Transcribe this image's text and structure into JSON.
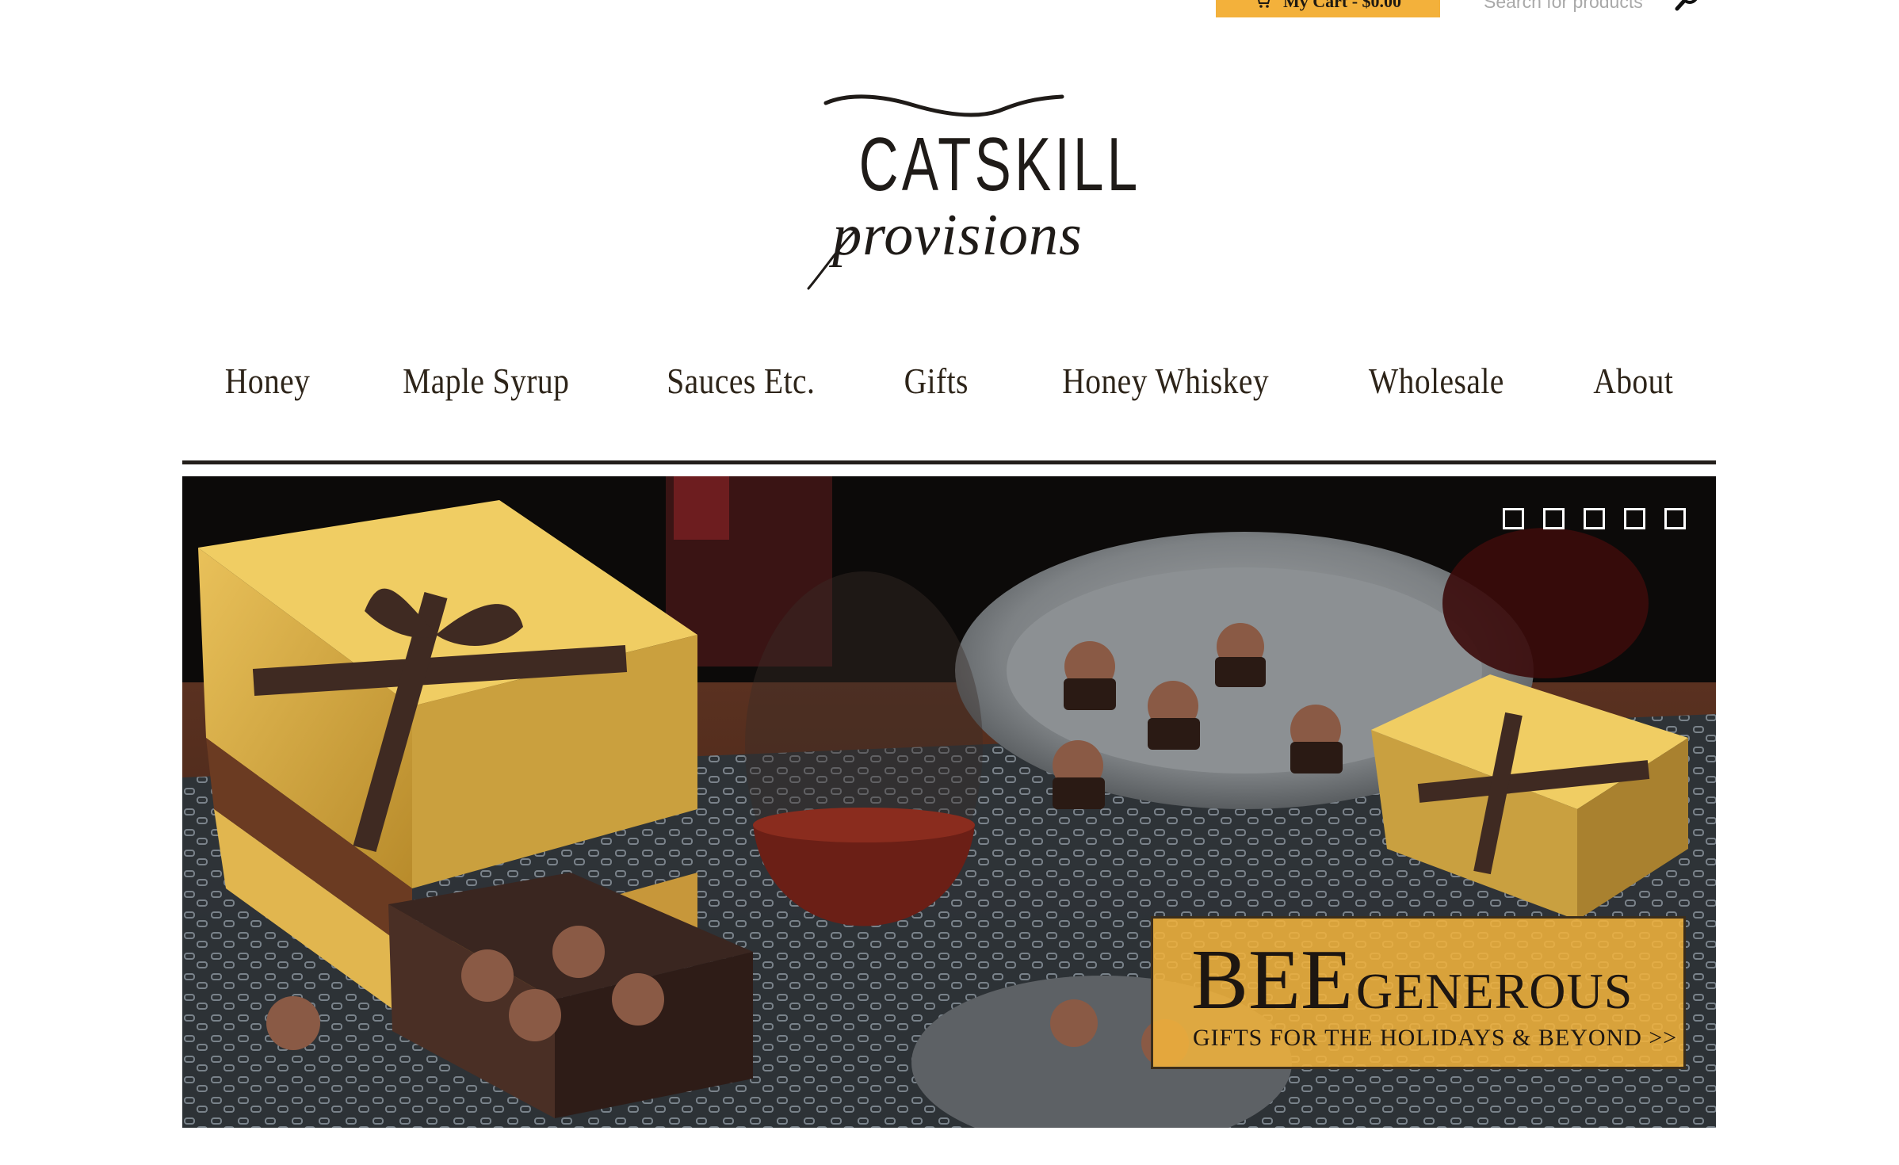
{
  "header": {
    "cart_label": "My Cart - $0.00",
    "search_placeholder": "Search for products"
  },
  "logo": {
    "line1": "CATSKILL",
    "line2": "provisions"
  },
  "nav": {
    "items": [
      {
        "label": "Honey"
      },
      {
        "label": "Maple Syrup"
      },
      {
        "label": "Sauces Etc."
      },
      {
        "label": "Gifts"
      },
      {
        "label": "Honey Whiskey"
      },
      {
        "label": "Wholesale"
      },
      {
        "label": "About"
      }
    ]
  },
  "hero": {
    "slide_count": 5,
    "active_slide": 1,
    "promo": {
      "title_big": "BEE",
      "title_small": "GENEROUS",
      "subtitle": "GIFTS FOR THE HOLIDAYS & BEYOND >>"
    }
  },
  "colors": {
    "accent": "#f3b13b",
    "nav_text": "#2d2419",
    "rule": "#231e1a"
  }
}
